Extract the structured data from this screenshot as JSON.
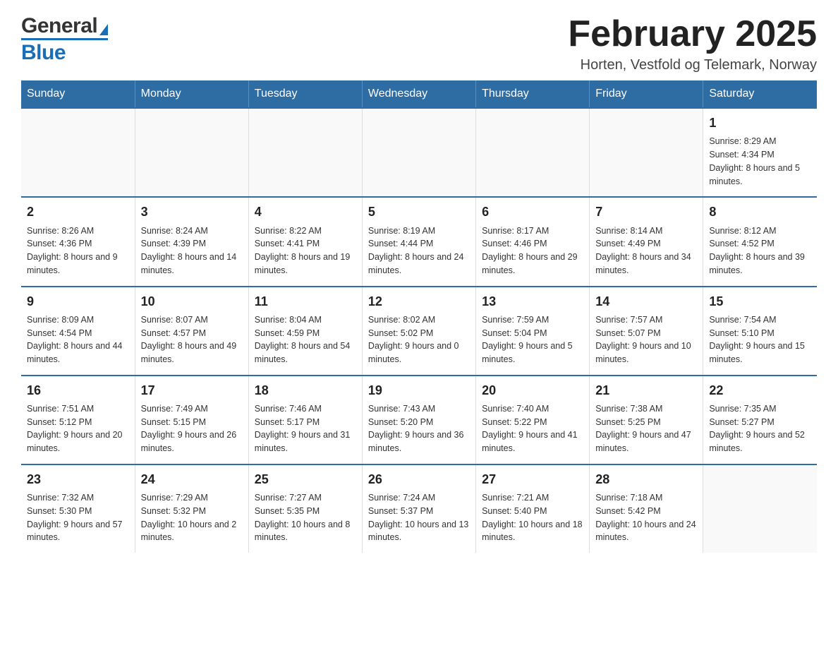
{
  "header": {
    "logo": {
      "general": "General",
      "blue": "Blue"
    },
    "title": "February 2025",
    "subtitle": "Horten, Vestfold og Telemark, Norway"
  },
  "calendar": {
    "weekdays": [
      "Sunday",
      "Monday",
      "Tuesday",
      "Wednesday",
      "Thursday",
      "Friday",
      "Saturday"
    ],
    "weeks": [
      [
        {
          "day": "",
          "info": ""
        },
        {
          "day": "",
          "info": ""
        },
        {
          "day": "",
          "info": ""
        },
        {
          "day": "",
          "info": ""
        },
        {
          "day": "",
          "info": ""
        },
        {
          "day": "",
          "info": ""
        },
        {
          "day": "1",
          "info": "Sunrise: 8:29 AM\nSunset: 4:34 PM\nDaylight: 8 hours and 5 minutes."
        }
      ],
      [
        {
          "day": "2",
          "info": "Sunrise: 8:26 AM\nSunset: 4:36 PM\nDaylight: 8 hours and 9 minutes."
        },
        {
          "day": "3",
          "info": "Sunrise: 8:24 AM\nSunset: 4:39 PM\nDaylight: 8 hours and 14 minutes."
        },
        {
          "day": "4",
          "info": "Sunrise: 8:22 AM\nSunset: 4:41 PM\nDaylight: 8 hours and 19 minutes."
        },
        {
          "day": "5",
          "info": "Sunrise: 8:19 AM\nSunset: 4:44 PM\nDaylight: 8 hours and 24 minutes."
        },
        {
          "day": "6",
          "info": "Sunrise: 8:17 AM\nSunset: 4:46 PM\nDaylight: 8 hours and 29 minutes."
        },
        {
          "day": "7",
          "info": "Sunrise: 8:14 AM\nSunset: 4:49 PM\nDaylight: 8 hours and 34 minutes."
        },
        {
          "day": "8",
          "info": "Sunrise: 8:12 AM\nSunset: 4:52 PM\nDaylight: 8 hours and 39 minutes."
        }
      ],
      [
        {
          "day": "9",
          "info": "Sunrise: 8:09 AM\nSunset: 4:54 PM\nDaylight: 8 hours and 44 minutes."
        },
        {
          "day": "10",
          "info": "Sunrise: 8:07 AM\nSunset: 4:57 PM\nDaylight: 8 hours and 49 minutes."
        },
        {
          "day": "11",
          "info": "Sunrise: 8:04 AM\nSunset: 4:59 PM\nDaylight: 8 hours and 54 minutes."
        },
        {
          "day": "12",
          "info": "Sunrise: 8:02 AM\nSunset: 5:02 PM\nDaylight: 9 hours and 0 minutes."
        },
        {
          "day": "13",
          "info": "Sunrise: 7:59 AM\nSunset: 5:04 PM\nDaylight: 9 hours and 5 minutes."
        },
        {
          "day": "14",
          "info": "Sunrise: 7:57 AM\nSunset: 5:07 PM\nDaylight: 9 hours and 10 minutes."
        },
        {
          "day": "15",
          "info": "Sunrise: 7:54 AM\nSunset: 5:10 PM\nDaylight: 9 hours and 15 minutes."
        }
      ],
      [
        {
          "day": "16",
          "info": "Sunrise: 7:51 AM\nSunset: 5:12 PM\nDaylight: 9 hours and 20 minutes."
        },
        {
          "day": "17",
          "info": "Sunrise: 7:49 AM\nSunset: 5:15 PM\nDaylight: 9 hours and 26 minutes."
        },
        {
          "day": "18",
          "info": "Sunrise: 7:46 AM\nSunset: 5:17 PM\nDaylight: 9 hours and 31 minutes."
        },
        {
          "day": "19",
          "info": "Sunrise: 7:43 AM\nSunset: 5:20 PM\nDaylight: 9 hours and 36 minutes."
        },
        {
          "day": "20",
          "info": "Sunrise: 7:40 AM\nSunset: 5:22 PM\nDaylight: 9 hours and 41 minutes."
        },
        {
          "day": "21",
          "info": "Sunrise: 7:38 AM\nSunset: 5:25 PM\nDaylight: 9 hours and 47 minutes."
        },
        {
          "day": "22",
          "info": "Sunrise: 7:35 AM\nSunset: 5:27 PM\nDaylight: 9 hours and 52 minutes."
        }
      ],
      [
        {
          "day": "23",
          "info": "Sunrise: 7:32 AM\nSunset: 5:30 PM\nDaylight: 9 hours and 57 minutes."
        },
        {
          "day": "24",
          "info": "Sunrise: 7:29 AM\nSunset: 5:32 PM\nDaylight: 10 hours and 2 minutes."
        },
        {
          "day": "25",
          "info": "Sunrise: 7:27 AM\nSunset: 5:35 PM\nDaylight: 10 hours and 8 minutes."
        },
        {
          "day": "26",
          "info": "Sunrise: 7:24 AM\nSunset: 5:37 PM\nDaylight: 10 hours and 13 minutes."
        },
        {
          "day": "27",
          "info": "Sunrise: 7:21 AM\nSunset: 5:40 PM\nDaylight: 10 hours and 18 minutes."
        },
        {
          "day": "28",
          "info": "Sunrise: 7:18 AM\nSunset: 5:42 PM\nDaylight: 10 hours and 24 minutes."
        },
        {
          "day": "",
          "info": ""
        }
      ]
    ]
  }
}
